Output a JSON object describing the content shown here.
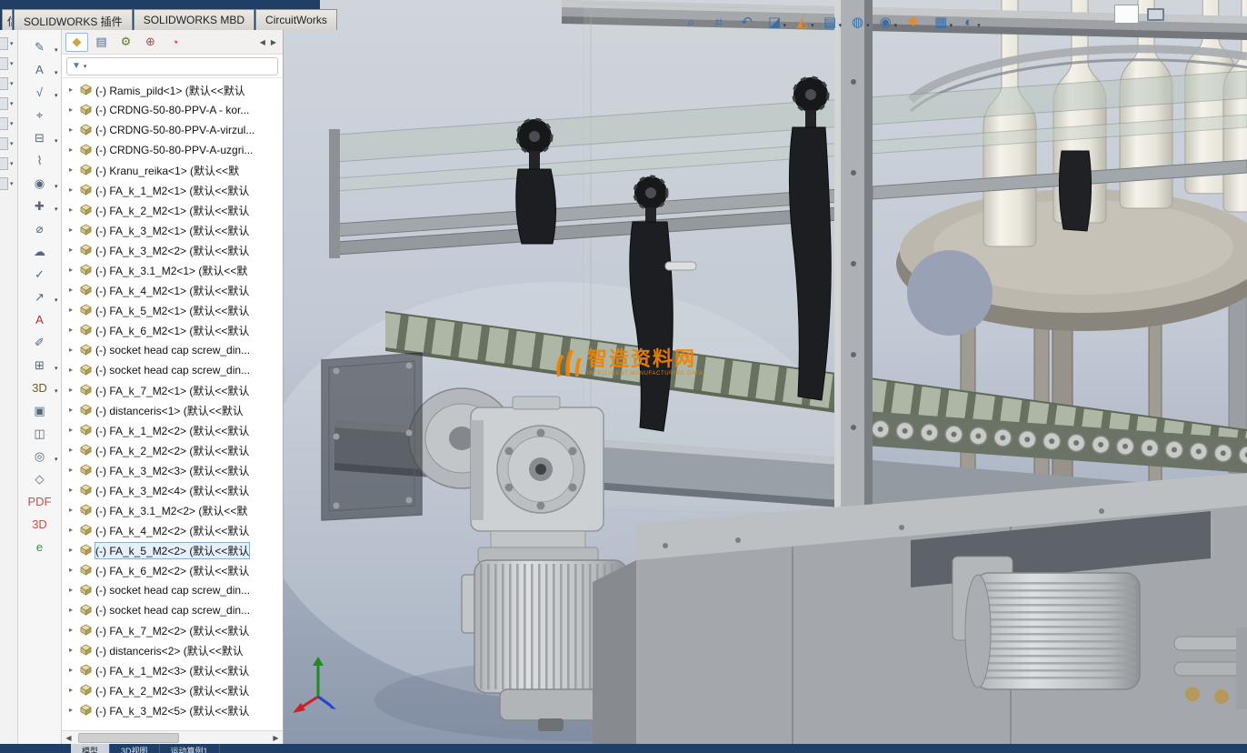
{
  "colors": {
    "titlebar_navy": "#1f3f66",
    "accent_orange": "#f08300",
    "viewport_gradient_top": "#d0d5dc",
    "viewport_gradient_bottom": "#8c98ac",
    "panel_white": "#ffffff"
  },
  "topbar": {
    "partial_tab": "估",
    "tabs": [
      "SOLIDWORKS 插件",
      "SOLIDWORKS MBD",
      "CircuitWorks"
    ]
  },
  "left_strip": {
    "dd_glyph": "▾",
    "items": [
      {
        "name": "clipped-tool-icon-1"
      },
      {
        "name": "clipped-tool-icon-2"
      },
      {
        "name": "clipped-tool-icon-3"
      },
      {
        "name": "clipped-tool-icon-4"
      },
      {
        "name": "clipped-tool-icon-5"
      },
      {
        "name": "clipped-tool-icon-6"
      },
      {
        "name": "clipped-tool-icon-7"
      },
      {
        "name": "clipped-tool-icon-8"
      }
    ]
  },
  "left_toolbar": {
    "dd_glyph": "▾",
    "items": [
      {
        "name": "sketch-icon",
        "glyph": "✎",
        "dd": true
      },
      {
        "name": "note-icon",
        "glyph": "A",
        "dd": true
      },
      {
        "name": "surface-finish-icon",
        "glyph": "√",
        "dd": true
      },
      {
        "name": "geometric-tolerance-icon",
        "glyph": "⌖",
        "dd": false
      },
      {
        "name": "datum-feature-icon",
        "glyph": "⊟",
        "dd": true
      },
      {
        "name": "weld-symbol-icon",
        "glyph": "⌇",
        "dd": false
      },
      {
        "name": "balloon-icon",
        "glyph": "◉",
        "dd": true
      },
      {
        "name": "magnetic-line-icon",
        "glyph": "✚",
        "dd": true
      },
      {
        "name": "hole-callout-icon",
        "glyph": "⌀",
        "dd": false
      },
      {
        "name": "revision-cloud-icon",
        "glyph": "☁",
        "dd": false
      },
      {
        "name": "spell-check-icon",
        "glyph": "✓",
        "dd": false
      },
      {
        "name": "smart-dimension-icon",
        "glyph": "↗",
        "dd": true
      },
      {
        "name": "format-text-icon",
        "glyph": "A",
        "dd": false,
        "color": "#b03030"
      },
      {
        "name": "format-painter-icon",
        "glyph": "✐",
        "dd": false
      },
      {
        "name": "tables-icon",
        "glyph": "⊞",
        "dd": true
      },
      {
        "name": "3d-view-icon",
        "glyph": "3D",
        "dd": true,
        "color": "#6b5d2e"
      },
      {
        "name": "capture-3d-view-icon",
        "glyph": "▣",
        "dd": false
      },
      {
        "name": "pmi-view-icon",
        "glyph": "◫",
        "dd": false
      },
      {
        "name": "dynamic-annotation-icon",
        "glyph": "◎",
        "dd": true
      },
      {
        "name": "clean-screen-icon",
        "glyph": "◇",
        "dd": false
      },
      {
        "name": "publish-pdf-icon",
        "glyph": "PDF",
        "dd": false,
        "color": "#c0504d"
      },
      {
        "name": "publish-3d-pdf-icon",
        "glyph": "3D",
        "dd": false,
        "color": "#c0504d"
      },
      {
        "name": "edrawings-icon",
        "glyph": "e",
        "dd": false,
        "color": "#1e9b4e"
      }
    ]
  },
  "tree_panel": {
    "tabs": [
      {
        "name": "featuremanager-tab",
        "glyph": "◆",
        "color": "#caa54a",
        "selected": true
      },
      {
        "name": "propertymanager-tab",
        "glyph": "▤",
        "color": "#3a6ea5"
      },
      {
        "name": "configurationmanager-tab",
        "glyph": "⚙",
        "color": "#5a7a3a"
      },
      {
        "name": "dimxpertmanager-tab",
        "glyph": "⊕",
        "color": "#a0504d"
      },
      {
        "name": "displaymanager-tab",
        "glyph": "◔",
        "color": "#cc4422"
      }
    ],
    "scroll_left": "◀",
    "scroll_right": "▶",
    "scroll_up": "▲",
    "scroll_down": "▼",
    "filter_glyph": "▼",
    "filter_dd_glyph": "▾",
    "expand_glyph": "▸",
    "items": [
      {
        "label": "(-) Ramis_pild<1> (默认<<默认"
      },
      {
        "label": "(-) CRDNG-50-80-PPV-A - kor..."
      },
      {
        "label": "(-) CRDNG-50-80-PPV-A-virzul..."
      },
      {
        "label": "(-) CRDNG-50-80-PPV-A-uzgri..."
      },
      {
        "label": "(-) Kranu_reika<1> (默认<<默"
      },
      {
        "label": "(-) FA_k_1_M2<1> (默认<<默认"
      },
      {
        "label": "(-) FA_k_2_M2<1> (默认<<默认"
      },
      {
        "label": "(-) FA_k_3_M2<1> (默认<<默认"
      },
      {
        "label": "(-) FA_k_3_M2<2> (默认<<默认"
      },
      {
        "label": "(-) FA_k_3.1_M2<1> (默认<<默"
      },
      {
        "label": "(-) FA_k_4_M2<1> (默认<<默认"
      },
      {
        "label": "(-) FA_k_5_M2<1> (默认<<默认"
      },
      {
        "label": "(-) FA_k_6_M2<1> (默认<<默认"
      },
      {
        "label": "(-) socket head cap screw_din..."
      },
      {
        "label": "(-) socket head cap screw_din..."
      },
      {
        "label": "(-) FA_k_7_M2<1> (默认<<默认"
      },
      {
        "label": "(-) distanceris<1> (默认<<默认"
      },
      {
        "label": "(-) FA_k_1_M2<2> (默认<<默认"
      },
      {
        "label": "(-) FA_k_2_M2<2> (默认<<默认"
      },
      {
        "label": "(-) FA_k_3_M2<3> (默认<<默认"
      },
      {
        "label": "(-) FA_k_3_M2<4> (默认<<默认"
      },
      {
        "label": "(-) FA_k_3.1_M2<2> (默认<<默"
      },
      {
        "label": "(-) FA_k_4_M2<2> (默认<<默认"
      },
      {
        "label": "(-) FA_k_5_M2<2> (默认<<默认",
        "selected": true
      },
      {
        "label": "(-) FA_k_6_M2<2> (默认<<默认"
      },
      {
        "label": "(-) socket head cap screw_din..."
      },
      {
        "label": "(-) socket head cap screw_din..."
      },
      {
        "label": "(-) FA_k_7_M2<2> (默认<<默认"
      },
      {
        "label": "(-) distanceris<2> (默认<<默认"
      },
      {
        "label": "(-) FA_k_1_M2<3> (默认<<默认"
      },
      {
        "label": "(-) FA_k_2_M2<3> (默认<<默认"
      },
      {
        "label": "(-) FA_k_3_M2<5> (默认<<默认"
      }
    ]
  },
  "hud": {
    "dd_glyph": "▾",
    "items": [
      {
        "name": "zoom-to-fit-icon",
        "glyph": "⌕",
        "color": "#3a6ea5",
        "dd": false
      },
      {
        "name": "zoom-to-area-icon",
        "glyph": "⌗",
        "color": "#3a6ea5",
        "dd": false
      },
      {
        "name": "previous-view-icon",
        "glyph": "↶",
        "color": "#3a6ea5",
        "dd": false
      },
      {
        "name": "section-view-icon",
        "glyph": "◪",
        "color": "#3a6ea5",
        "dd": true
      },
      {
        "name": "dynamic-annotation-view-icon",
        "glyph": "◭",
        "color": "#e08a2e",
        "dd": true
      },
      {
        "name": "view-orientation-icon",
        "glyph": "▤",
        "color": "#3a6ea5",
        "dd": true
      },
      {
        "name": "display-style-icon",
        "glyph": "◍",
        "color": "#3a6ea5",
        "dd": true
      },
      {
        "name": "hide-show-items-icon",
        "glyph": "◉",
        "color": "#3a6ea5",
        "dd": true
      },
      {
        "name": "edit-appearance-icon",
        "glyph": "❖",
        "color": "#e08a2e",
        "dd": false
      },
      {
        "name": "apply-scene-icon",
        "glyph": "▦",
        "color": "#3a6ea5",
        "dd": true
      },
      {
        "name": "view-settings-icon",
        "glyph": "◐",
        "color": "#3a6ea5",
        "dd": true
      }
    ]
  },
  "watermark": {
    "title": "智造资料网",
    "subtitle": "INTELLIGENT MANUFACTURING DATA"
  },
  "statusbar": {
    "tabs": [
      {
        "name": "status-tab-model",
        "label": "模型",
        "selected": true
      },
      {
        "name": "status-tab-3d-views",
        "label": "3D视图",
        "selected": false
      },
      {
        "name": "status-tab-motion-study",
        "label": "运动算例1",
        "selected": false
      }
    ]
  }
}
